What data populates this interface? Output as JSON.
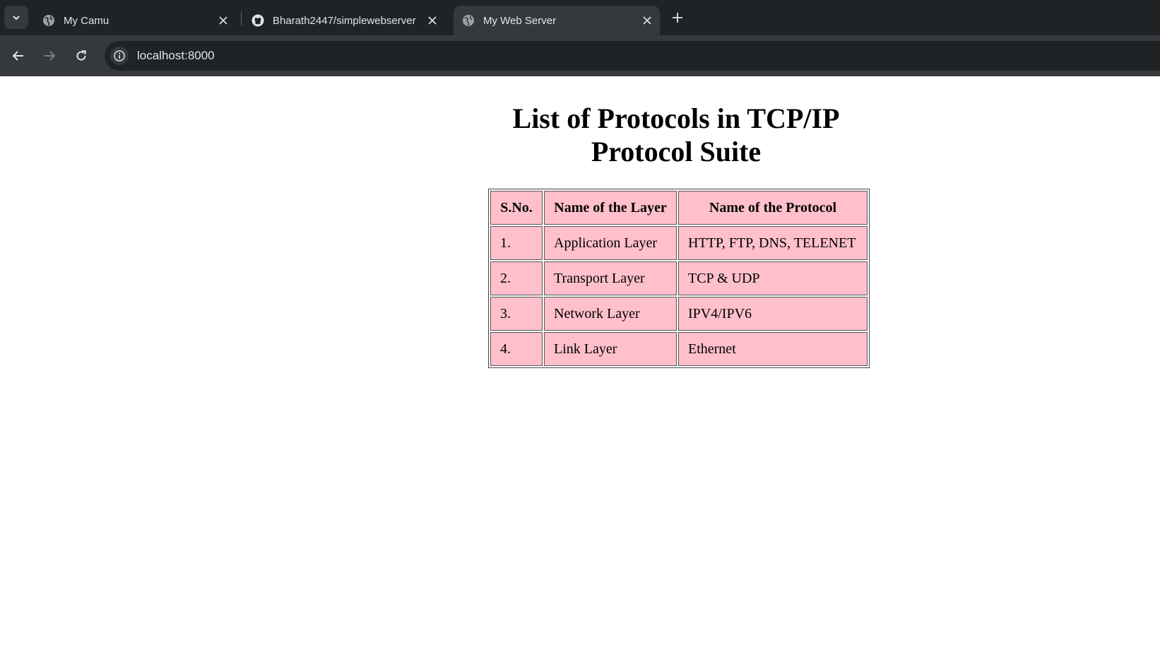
{
  "browser": {
    "tabs": [
      {
        "title": "My Camu",
        "icon": "globe-icon",
        "active": false
      },
      {
        "title": "Bharath2447/simplewebserver",
        "icon": "github-icon",
        "active": false
      },
      {
        "title": "My Web Server",
        "icon": "globe-icon",
        "active": true
      }
    ],
    "url": "localhost:8000"
  },
  "page": {
    "title": "List of Protocols in TCP/IP Protocol Suite",
    "table": {
      "headers": [
        "S.No.",
        "Name of the Layer",
        "Name of the Protocol"
      ],
      "rows": [
        [
          "1.",
          "Application Layer",
          "HTTP, FTP, DNS, TELENET"
        ],
        [
          "2.",
          "Transport Layer",
          "TCP & UDP"
        ],
        [
          "3.",
          "Network Layer",
          "IPV4/IPV6"
        ],
        [
          "4.",
          "Link Layer",
          "Ethernet"
        ]
      ],
      "cell_color": "#ffc0cb"
    }
  }
}
